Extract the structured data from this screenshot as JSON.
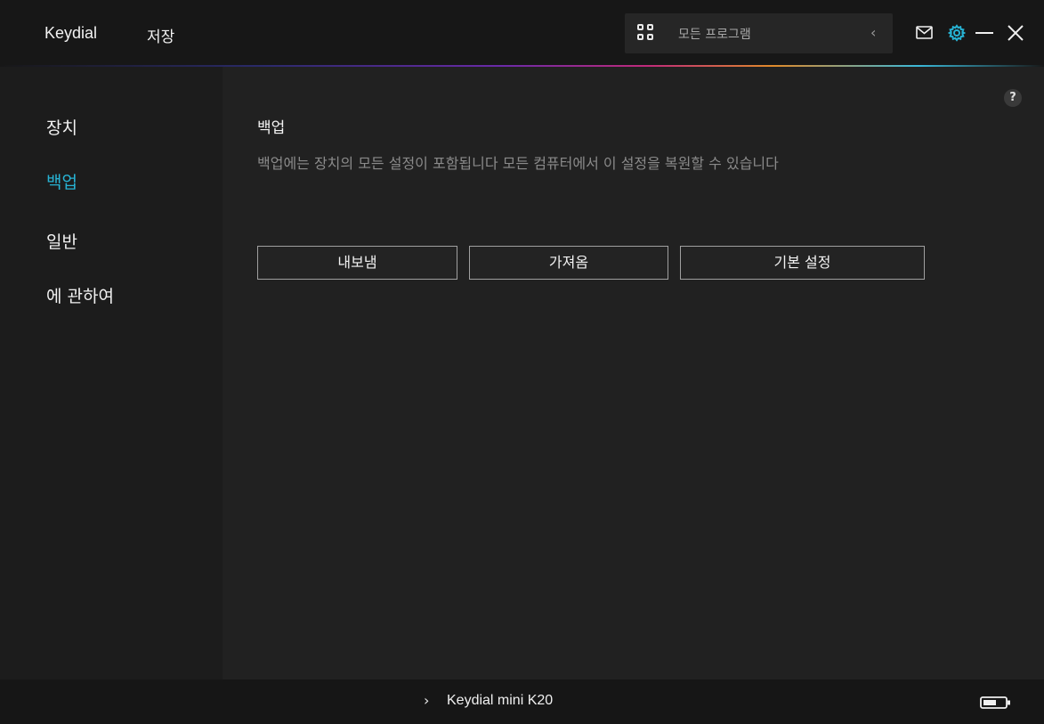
{
  "header": {
    "app_title": "Keydial",
    "save_tab": "저장",
    "program_selector": {
      "label": "모든 프로그램",
      "icon": "grid-icon"
    },
    "icons": [
      "mail-icon",
      "gear-icon",
      "minimize-icon",
      "close-icon"
    ]
  },
  "sidebar": {
    "items": [
      {
        "label": "장치",
        "active": false
      },
      {
        "label": "백업",
        "active": true
      },
      {
        "label": "일반",
        "active": false
      },
      {
        "label": "에 관하여",
        "active": false
      }
    ]
  },
  "main": {
    "help": "?",
    "title": "백업",
    "description": "백업에는 장치의 모든 설정이 포함됩니다 모든 컴퓨터에서 이 설정을 복원할 수 있습니다",
    "buttons": {
      "export": "내보냄",
      "import": "가져옴",
      "default": "기본 설정"
    }
  },
  "footer": {
    "device_name": "Keydial mini K20",
    "battery_icon": "battery-icon"
  },
  "colors": {
    "accent": "#27b3d4",
    "background": "#202020",
    "sidebar": "#1c1c1c",
    "topbar": "#171717"
  }
}
